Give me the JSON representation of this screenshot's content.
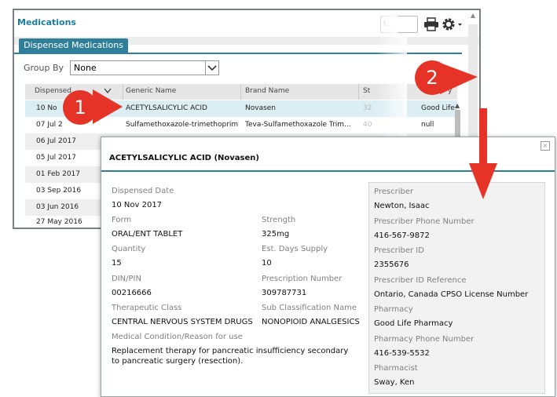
{
  "panel": {
    "title": "Medications",
    "tab": "Dispensed Medications",
    "search_partial": "t...",
    "group_by_label": "Group By",
    "group_by_value": "None",
    "columns": [
      "Dispensed",
      "Generic Name",
      "Brand Name",
      "St",
      "y"
    ],
    "rows": [
      {
        "date": "10 No",
        "generic": "ACETYLSALICYLIC ACID",
        "brand": "Novasen",
        "strength": "32",
        "pharmacy": "Good Life"
      },
      {
        "date": "07 Jul 2",
        "generic": "Sulfamethoxazole-trimethoprim",
        "brand": "Teva-Sulfamethoxazole Trim...",
        "strength": "40",
        "pharmacy": "null"
      },
      {
        "date": "06 Jul 2017"
      },
      {
        "date": "05 Jul 2017"
      },
      {
        "date": "01 Feb 2017"
      },
      {
        "date": "03 Sep 2016"
      },
      {
        "date": "03 Jun 2016"
      },
      {
        "date": "27 May 2016"
      }
    ]
  },
  "callouts": {
    "one": "1",
    "two": "2"
  },
  "popup": {
    "title": "ACETYLSALICYLIC ACID (Novasen)",
    "close_glyph": "×",
    "dispensed_date_label": "Dispensed Date",
    "dispensed_date": "10 Nov 2017",
    "form_label": "Form",
    "form": "ORAL/ENT TABLET",
    "strength_label": "Strength",
    "strength": "325mg",
    "quantity_label": "Quantity",
    "quantity": "15",
    "days_supply_label": "Est. Days Supply",
    "days_supply": "10",
    "din_label": "DIN/PIN",
    "din": "00216666",
    "rx_number_label": "Prescription Number",
    "rx_number": "309787731",
    "therapeutic_class_label": "Therapeutic Class",
    "therapeutic_class": "CENTRAL NERVOUS SYSTEM DRUGS",
    "sub_class_label": "Sub Classification Name",
    "sub_class": "NONOPIOID ANALGESICS",
    "condition_label": "Medical Condition/Reason for use",
    "condition": "Replacement therapy for pancreatic insufficiency secondary to pancreatic surgery (resection).",
    "prescriber_label": "Prescriber",
    "prescriber": "Newton, Isaac",
    "prescriber_phone_label": "Prescriber Phone Number",
    "prescriber_phone": "416-567-9872",
    "prescriber_id_label": "Prescriber ID",
    "prescriber_id": "2355676",
    "prescriber_ref_label": "Prescriber ID Reference",
    "prescriber_ref": "Ontario, Canada CPSO License Number",
    "pharmacy_label": "Pharmacy",
    "pharmacy": "Good Life Pharmacy",
    "pharmacy_phone_label": "Pharmacy Phone Number",
    "pharmacy_phone": "416-539-5532",
    "pharmacist_label": "Pharmacist",
    "pharmacist": "Sway, Ken"
  },
  "colors": {
    "accent": "#2f7f9a",
    "title": "#1a7ea0",
    "callout": "#e53327",
    "selected_row": "#dbeef4"
  },
  "icons": [
    "print-icon",
    "gear-icon",
    "chevron-down-icon",
    "close-icon",
    "sort-arrow-icon"
  ]
}
